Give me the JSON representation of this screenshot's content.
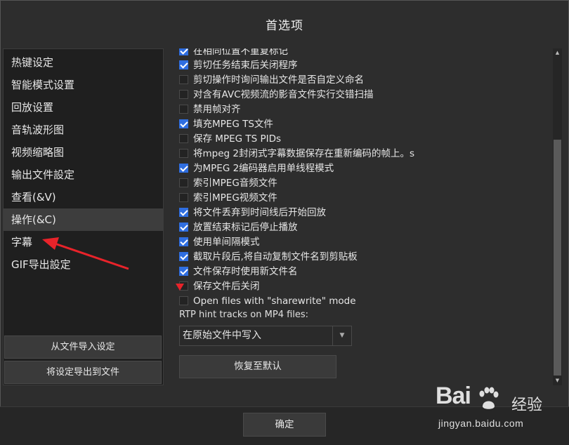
{
  "window": {
    "title": "首选项"
  },
  "sidebar": {
    "items": [
      {
        "label": "热键设定"
      },
      {
        "label": "智能模式设置"
      },
      {
        "label": "回放设置"
      },
      {
        "label": "音轨波形图"
      },
      {
        "label": "视频缩略图"
      },
      {
        "label": "输出文件設定"
      },
      {
        "label": "查看(&V)"
      },
      {
        "label": "操作(&C)",
        "active": true
      },
      {
        "label": "字幕"
      },
      {
        "label": "GIF导出設定"
      }
    ],
    "import_label": "从文件导入设定",
    "export_label": "将设定导出到文件"
  },
  "main": {
    "options": [
      {
        "label": "在相同位置不重复标记",
        "checked": true
      },
      {
        "label": "剪切任务结束后关闭程序",
        "checked": true
      },
      {
        "label": "剪切操作时询问输出文件是否自定义命名",
        "checked": false
      },
      {
        "label": "对含有AVC视频流的影音文件实行交错扫描",
        "checked": false
      },
      {
        "label": "禁用帧对齐",
        "checked": false
      },
      {
        "label": "填充MPEG TS文件",
        "checked": true
      },
      {
        "label": "保存 MPEG TS PIDs",
        "checked": false
      },
      {
        "label": "将mpeg 2封闭式字幕数据保存在重新编码的帧上。s",
        "checked": false
      },
      {
        "label": "为MPEG 2编码器启用单线程模式",
        "checked": true
      },
      {
        "label": "索引MPEG音频文件",
        "checked": false
      },
      {
        "label": "索引MPEG视频文件",
        "checked": false
      },
      {
        "label": "将文件丢弃到时间线后开始回放",
        "checked": true
      },
      {
        "label": "放置结束标记后停止播放",
        "checked": true
      },
      {
        "label": "使用单间隔模式",
        "checked": true
      },
      {
        "label": "截取片段后,将自动复制文件名到剪贴板",
        "checked": true
      },
      {
        "label": "文件保存时使用新文件名",
        "checked": true
      },
      {
        "label": "保存文件后关闭",
        "checked": false
      },
      {
        "label": "Open files with \"sharewrite\" mode",
        "checked": false
      }
    ],
    "rtp_label": "RTP hint tracks on MP4 files:",
    "rtp_select_value": "在原始文件中写入",
    "reset_label": "恢复至默认"
  },
  "footer": {
    "ok_label": "确定"
  },
  "watermark": {
    "brand": "Bai",
    "brand_cn": "经验",
    "url": "jingyan.baidu.com"
  },
  "colors": {
    "accent": "#2f6ee0",
    "annotation": "#e8232a",
    "background": "#2d2d2d"
  }
}
